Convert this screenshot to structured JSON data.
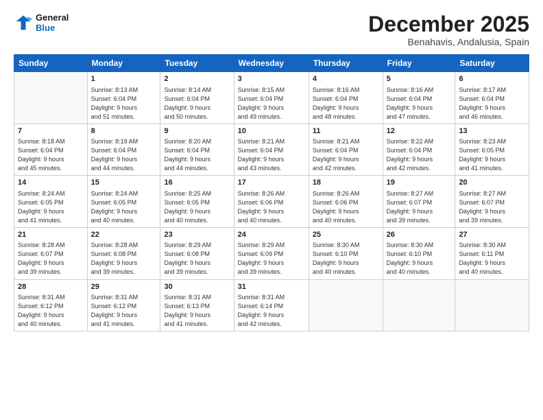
{
  "logo": {
    "line1": "General",
    "line2": "Blue"
  },
  "title": "December 2025",
  "location": "Benahavis, Andalusia, Spain",
  "days_of_week": [
    "Sunday",
    "Monday",
    "Tuesday",
    "Wednesday",
    "Thursday",
    "Friday",
    "Saturday"
  ],
  "weeks": [
    [
      {
        "day": "",
        "text": ""
      },
      {
        "day": "1",
        "text": "Sunrise: 8:13 AM\nSunset: 6:04 PM\nDaylight: 9 hours\nand 51 minutes."
      },
      {
        "day": "2",
        "text": "Sunrise: 8:14 AM\nSunset: 6:04 PM\nDaylight: 9 hours\nand 50 minutes."
      },
      {
        "day": "3",
        "text": "Sunrise: 8:15 AM\nSunset: 6:04 PM\nDaylight: 9 hours\nand 49 minutes."
      },
      {
        "day": "4",
        "text": "Sunrise: 8:16 AM\nSunset: 6:04 PM\nDaylight: 9 hours\nand 48 minutes."
      },
      {
        "day": "5",
        "text": "Sunrise: 8:16 AM\nSunset: 6:04 PM\nDaylight: 9 hours\nand 47 minutes."
      },
      {
        "day": "6",
        "text": "Sunrise: 8:17 AM\nSunset: 6:04 PM\nDaylight: 9 hours\nand 46 minutes."
      }
    ],
    [
      {
        "day": "7",
        "text": "Sunrise: 8:18 AM\nSunset: 6:04 PM\nDaylight: 9 hours\nand 45 minutes."
      },
      {
        "day": "8",
        "text": "Sunrise: 8:19 AM\nSunset: 6:04 PM\nDaylight: 9 hours\nand 44 minutes."
      },
      {
        "day": "9",
        "text": "Sunrise: 8:20 AM\nSunset: 6:04 PM\nDaylight: 9 hours\nand 44 minutes."
      },
      {
        "day": "10",
        "text": "Sunrise: 8:21 AM\nSunset: 6:04 PM\nDaylight: 9 hours\nand 43 minutes."
      },
      {
        "day": "11",
        "text": "Sunrise: 8:21 AM\nSunset: 6:04 PM\nDaylight: 9 hours\nand 42 minutes."
      },
      {
        "day": "12",
        "text": "Sunrise: 8:22 AM\nSunset: 6:04 PM\nDaylight: 9 hours\nand 42 minutes."
      },
      {
        "day": "13",
        "text": "Sunrise: 8:23 AM\nSunset: 6:05 PM\nDaylight: 9 hours\nand 41 minutes."
      }
    ],
    [
      {
        "day": "14",
        "text": "Sunrise: 8:24 AM\nSunset: 6:05 PM\nDaylight: 9 hours\nand 41 minutes."
      },
      {
        "day": "15",
        "text": "Sunrise: 8:24 AM\nSunset: 6:05 PM\nDaylight: 9 hours\nand 40 minutes."
      },
      {
        "day": "16",
        "text": "Sunrise: 8:25 AM\nSunset: 6:05 PM\nDaylight: 9 hours\nand 40 minutes."
      },
      {
        "day": "17",
        "text": "Sunrise: 8:26 AM\nSunset: 6:06 PM\nDaylight: 9 hours\nand 40 minutes."
      },
      {
        "day": "18",
        "text": "Sunrise: 8:26 AM\nSunset: 6:06 PM\nDaylight: 9 hours\nand 40 minutes."
      },
      {
        "day": "19",
        "text": "Sunrise: 8:27 AM\nSunset: 6:07 PM\nDaylight: 9 hours\nand 39 minutes."
      },
      {
        "day": "20",
        "text": "Sunrise: 8:27 AM\nSunset: 6:07 PM\nDaylight: 9 hours\nand 39 minutes."
      }
    ],
    [
      {
        "day": "21",
        "text": "Sunrise: 8:28 AM\nSunset: 6:07 PM\nDaylight: 9 hours\nand 39 minutes."
      },
      {
        "day": "22",
        "text": "Sunrise: 8:28 AM\nSunset: 6:08 PM\nDaylight: 9 hours\nand 39 minutes."
      },
      {
        "day": "23",
        "text": "Sunrise: 8:29 AM\nSunset: 6:08 PM\nDaylight: 9 hours\nand 39 minutes."
      },
      {
        "day": "24",
        "text": "Sunrise: 8:29 AM\nSunset: 6:09 PM\nDaylight: 9 hours\nand 39 minutes."
      },
      {
        "day": "25",
        "text": "Sunrise: 8:30 AM\nSunset: 6:10 PM\nDaylight: 9 hours\nand 40 minutes."
      },
      {
        "day": "26",
        "text": "Sunrise: 8:30 AM\nSunset: 6:10 PM\nDaylight: 9 hours\nand 40 minutes."
      },
      {
        "day": "27",
        "text": "Sunrise: 8:30 AM\nSunset: 6:11 PM\nDaylight: 9 hours\nand 40 minutes."
      }
    ],
    [
      {
        "day": "28",
        "text": "Sunrise: 8:31 AM\nSunset: 6:12 PM\nDaylight: 9 hours\nand 40 minutes."
      },
      {
        "day": "29",
        "text": "Sunrise: 8:31 AM\nSunset: 6:12 PM\nDaylight: 9 hours\nand 41 minutes."
      },
      {
        "day": "30",
        "text": "Sunrise: 8:31 AM\nSunset: 6:13 PM\nDaylight: 9 hours\nand 41 minutes."
      },
      {
        "day": "31",
        "text": "Sunrise: 8:31 AM\nSunset: 6:14 PM\nDaylight: 9 hours\nand 42 minutes."
      },
      {
        "day": "",
        "text": ""
      },
      {
        "day": "",
        "text": ""
      },
      {
        "day": "",
        "text": ""
      }
    ]
  ]
}
